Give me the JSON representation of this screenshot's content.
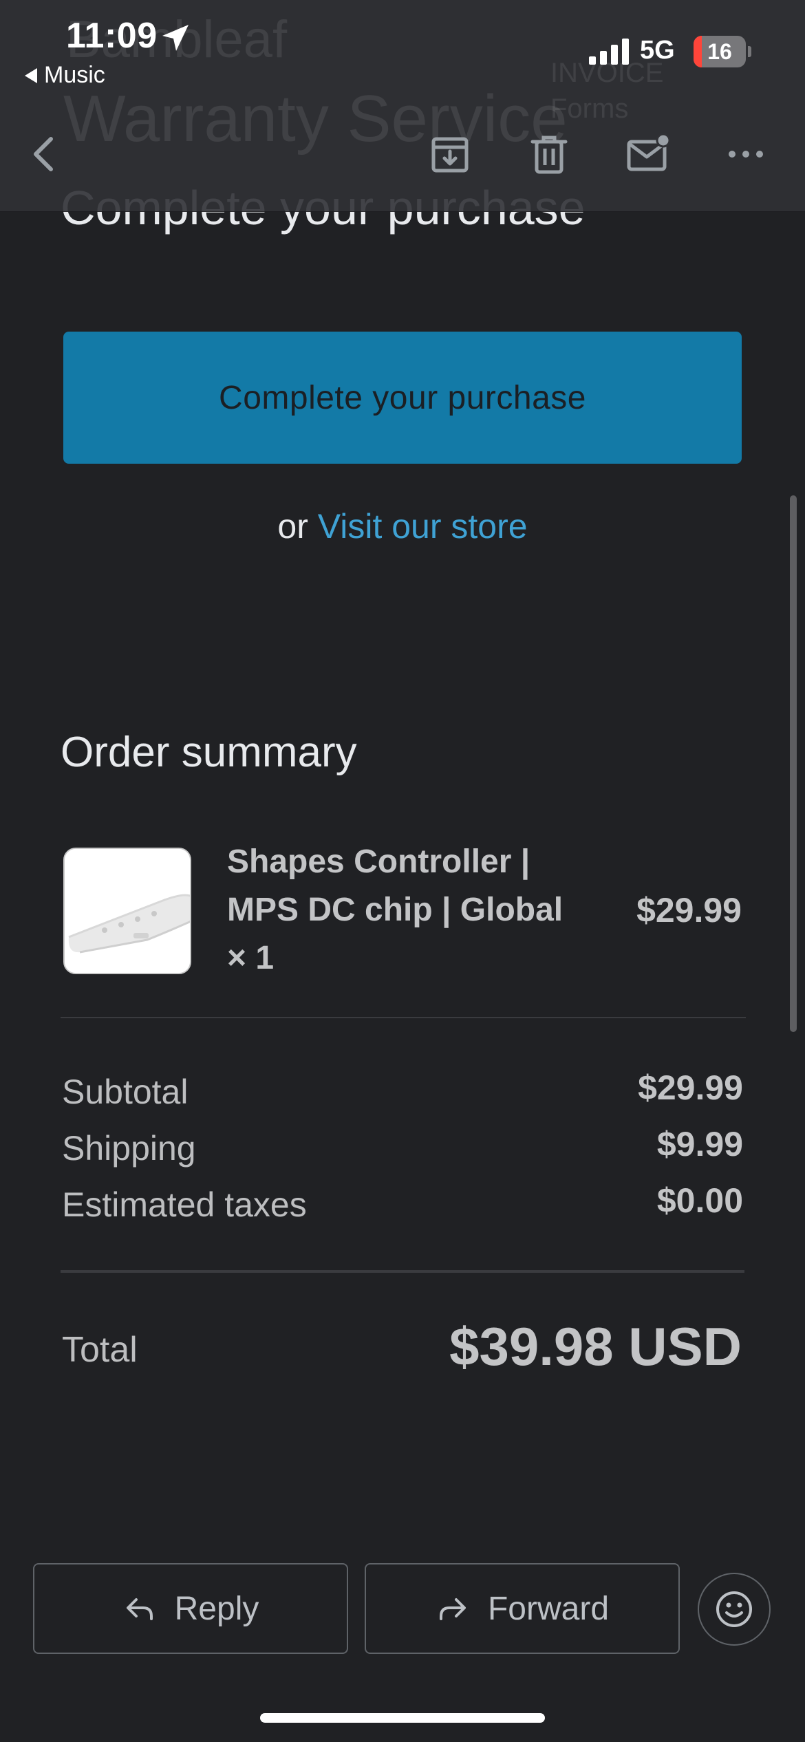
{
  "status_bar": {
    "time": "11:09",
    "back_app": "Music",
    "network": "5G",
    "battery_level": "16",
    "battery_fraction": 0.16
  },
  "ghost_header": {
    "brand": "Bambleaf",
    "title": "Warranty Service",
    "sub1": "INVOICE",
    "sub2": "Forms"
  },
  "toolbar": {
    "back_icon": "chevron-left-icon",
    "archive_icon": "archive-icon",
    "delete_icon": "trash-icon",
    "mark_unread_icon": "mail-unread-icon",
    "more_icon": "more-horizontal-icon"
  },
  "email": {
    "partial_heading": "Complete your purchase",
    "cta_label": "Complete your purchase",
    "store_prefix": "or",
    "store_link": "Visit our store",
    "order_summary_title": "Order summary",
    "item": {
      "name": "Shapes Controller | MPS DC chip | Global × 1",
      "price": "$29.99"
    },
    "totals": [
      {
        "label": "Subtotal",
        "value": "$29.99"
      },
      {
        "label": "Shipping",
        "value": "$9.99"
      },
      {
        "label": "Estimated taxes",
        "value": "$0.00"
      }
    ],
    "total_label": "Total",
    "total_value": "$39.98 USD"
  },
  "actions": {
    "reply": "Reply",
    "forward": "Forward",
    "emoji_icon": "smiley-icon"
  },
  "colors": {
    "background": "#202124",
    "cta": "#137aa7",
    "link": "#3fa2d4"
  }
}
